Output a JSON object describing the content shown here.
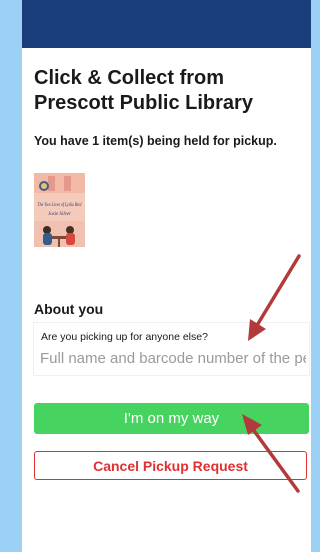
{
  "page": {
    "title": "Click & Collect from Prescott Public Library",
    "held_message": "You have 1 item(s) being held for pickup."
  },
  "book": {
    "title": "The Two Lives of Lydia Bird",
    "author": "Josie Silver"
  },
  "about": {
    "heading": "About you",
    "question_label": "Are you picking up for anyone else?",
    "input_placeholder": "Full name and barcode number of the person",
    "input_value": ""
  },
  "actions": {
    "on_my_way_label": "I'm on my way",
    "cancel_label": "Cancel Pickup Request"
  },
  "colors": {
    "header_bar": "#1a3d7c",
    "background": "#9dd0f5",
    "primary_button": "#47d35f",
    "cancel": "#e03131",
    "annotation_arrow": "#b23a3a"
  }
}
